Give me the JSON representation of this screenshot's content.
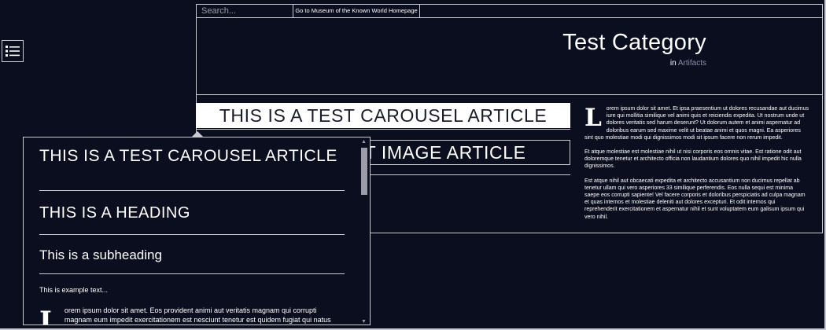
{
  "header": {
    "search_placeholder": "Search...",
    "home_link": "Go to Museum of the Known World Homepage",
    "title": "Test Category",
    "subtitle_prefix": "in",
    "subtitle_link": "Artifacts"
  },
  "carousel": {
    "items": [
      "THIS IS A TEST CAROUSEL ARTICLE",
      "THIS IS A TEST IMAGE ARTICLE"
    ]
  },
  "article": {
    "dropcap": "L",
    "paragraphs": [
      "orem ipsum dolor sit amet. Et ipsa praesentium ut dolores recusandae aut ducimus iure qui mollitia similique vel animi quis et reiciendis expedita. Ut nostrum unde ut dolores veritatis sed harum deserunt? Ut dolorum autem et animi aspernatur ad doloribus earum sed maxime velit ut beatae animi et quos magni. Ea asperiores sint quo molestiae modi qui dignissimos modi sit ipsum facere non rerum impedit.",
      "Et atque molestiae est molestiae nihil ut nisi corporis eos omnis vitae. Est ratione odit aut doloremque tenetur et architecto officia non laudantium dolores quo nihil impedit hic nulla dignissimos.",
      "Est atque nihil aut obcaecati expedita et architecto accusantium non ducimus repellat ab tenetur ullam qui vero asperiores 33 similique perferendis. Eos nulla sequi est minima saepe eos corrupti sapiente! Vel facere corporis et doloribus perspiciatis ad culpa magnam et quas internos et molestiae deleniti aut dolores excepturi. Et odit internos qui reprehenderit exercitationem et aspernatur nihil et sunt voluptatem eum galisum ipsum qui vero nihil."
    ]
  },
  "toc": {
    "heading1": "THIS IS A TEST CAROUSEL ARTICLE",
    "heading2": "THIS IS A HEADING",
    "subheading": "This is a subheading",
    "example_text": "This is example text...",
    "dropcap": "L",
    "body": "orem ipsum dolor sit amet. Eos provident animi aut veritatis magnam qui corrupti magnam eum impedit exercitationem est nesciunt tenetur est quidem fugiat qui natus magni. Non"
  },
  "icons": {
    "menu": "list-icon",
    "scroll_up": "scroll-up-arrow-icon",
    "scroll_down": "scroll-down-arrow-icon"
  }
}
